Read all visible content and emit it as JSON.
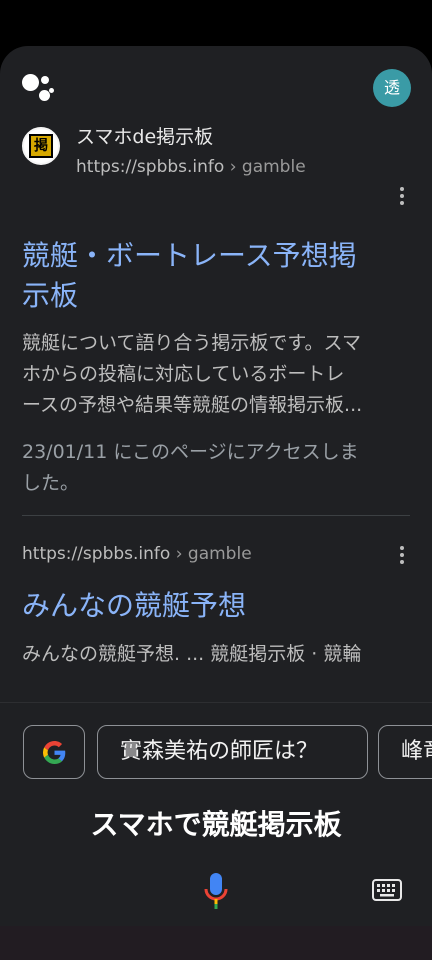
{
  "header": {
    "avatar_initial": "透"
  },
  "results": [
    {
      "favicon_glyph": "掲",
      "site_name": "スマホde掲示板",
      "url": "https://spbbs.info",
      "crumb": " › gamble",
      "title_line1": "競艇・ボートレース予想掲",
      "title_line2": "示板",
      "snippet": "競艇について語り合う掲示板です。スマ\nホからの投稿に対応しているボートレ\nースの予想や結果等競艇の情報掲示板...",
      "visited": "23/01/11 にこのページにアクセスしま\nした。"
    },
    {
      "url": "https://spbbs.info",
      "crumb": " › gamble",
      "title": "みんなの競艇予想",
      "snippet": "みんなの競艇予想. ... 競艇掲示板 · 競輪\n掲示板 · 競馬掲示板 ... チケットの特徴..."
    }
  ],
  "suggestions": {
    "chip1": "實森美祐の師匠は？",
    "chip2": "峰竜"
  },
  "query": "スマホで競艇掲示板",
  "icons": {
    "assistant": "google-assistant-icon",
    "more": "more-vert-icon",
    "google": "google-g-icon",
    "mic": "mic-icon",
    "keyboard": "keyboard-icon"
  },
  "colors": {
    "background": "#1f2023",
    "link": "#8ab4f8",
    "avatar": "#3a9ba6"
  }
}
